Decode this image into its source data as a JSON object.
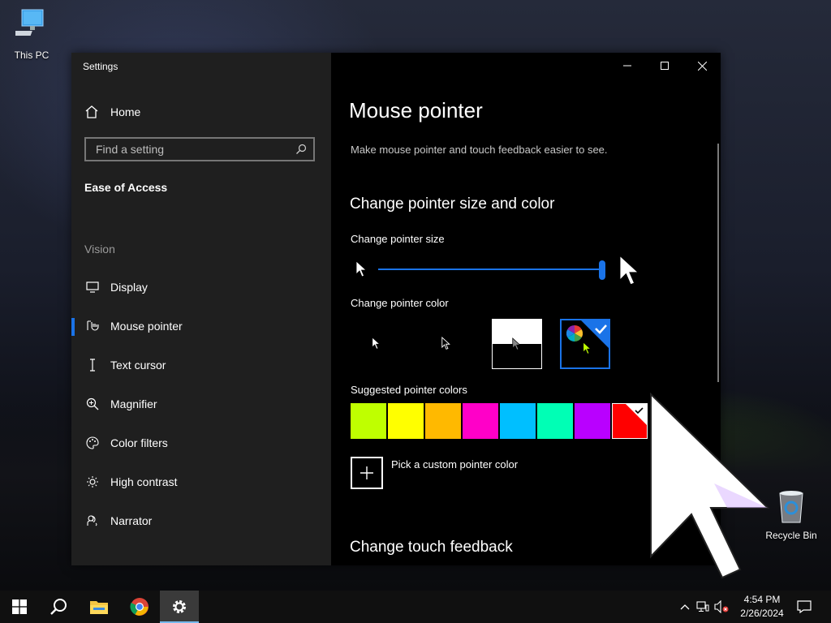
{
  "desktop": {
    "icons": [
      {
        "label": "This PC"
      },
      {
        "label": "Recycle Bin"
      }
    ]
  },
  "window": {
    "app_title": "Settings",
    "sidebar": {
      "home_label": "Home",
      "search_placeholder": "Find a setting",
      "section": "Ease of Access",
      "group": "Vision",
      "items": [
        {
          "label": "Display",
          "icon": "monitor-icon"
        },
        {
          "label": "Mouse pointer",
          "icon": "mouse-pointer-icon",
          "selected": true
        },
        {
          "label": "Text cursor",
          "icon": "text-cursor-icon"
        },
        {
          "label": "Magnifier",
          "icon": "magnifier-icon"
        },
        {
          "label": "Color filters",
          "icon": "palette-icon"
        },
        {
          "label": "High contrast",
          "icon": "sun-icon"
        },
        {
          "label": "Narrator",
          "icon": "narrator-icon"
        }
      ]
    },
    "content": {
      "title": "Mouse pointer",
      "description": "Make mouse pointer and touch feedback easier to see.",
      "section_size_color": "Change pointer size and color",
      "size_label": "Change pointer size",
      "size_value_fraction": 1.0,
      "color_label": "Change pointer color",
      "color_options": [
        "white",
        "black",
        "inverted",
        "custom"
      ],
      "selected_color_option": "custom",
      "suggested_label": "Suggested pointer colors",
      "suggested_colors": [
        "#bfff00",
        "#ffff00",
        "#ffb900",
        "#ff00c8",
        "#00bfff",
        "#00ffb5",
        "#b900ff",
        "#ff0000"
      ],
      "selected_suggested_color": "#ff0000",
      "custom_label": "Pick a custom pointer color",
      "section_touch": "Change touch feedback"
    }
  },
  "taskbar": {
    "time": "4:54 PM",
    "date": "2/26/2024"
  },
  "colors": {
    "accent": "#1a73e8",
    "sidebar_bg": "#1f1f1f",
    "content_bg": "#000000"
  }
}
